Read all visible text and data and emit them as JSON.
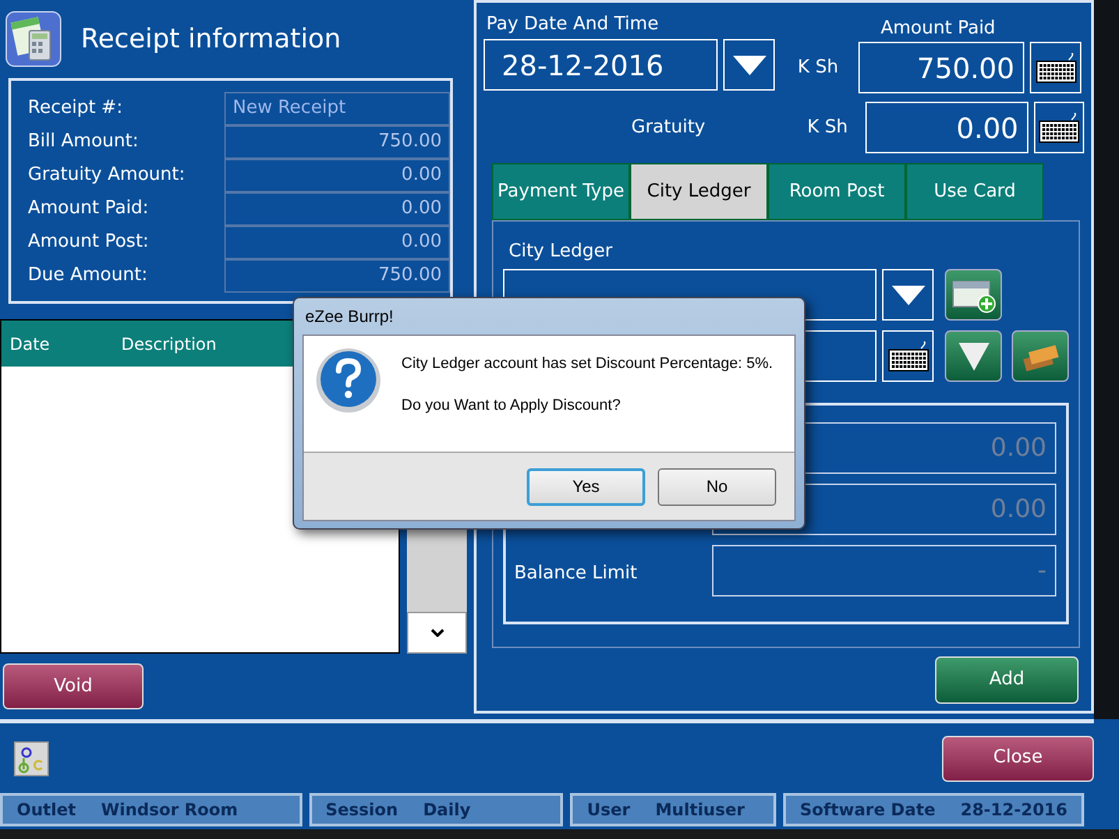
{
  "header": {
    "title": "Receipt information"
  },
  "receipt_info": [
    {
      "label": "Receipt #:",
      "value": "New Receipt",
      "kind": "text"
    },
    {
      "label": "Bill Amount:",
      "value": "750.00",
      "kind": "amount"
    },
    {
      "label": "Gratuity Amount:",
      "value": "0.00",
      "kind": "amount"
    },
    {
      "label": "Amount Paid:",
      "value": "0.00",
      "kind": "amount"
    },
    {
      "label": "Amount Post:",
      "value": "0.00",
      "kind": "amount"
    },
    {
      "label": "Due Amount:",
      "value": "750.00",
      "kind": "amount"
    }
  ],
  "transactions_table": {
    "columns": [
      "Date",
      "Description"
    ]
  },
  "void_button": "Void",
  "payment": {
    "pay_date_label": "Pay Date And Time",
    "pay_date": "28-12-2016",
    "amount_paid_label": "Amount Paid",
    "amount_currency": "K Sh",
    "amount_paid": "750.00",
    "gratuity_label": "Gratuity",
    "gratuity_currency": "K Sh",
    "gratuity": "0.00"
  },
  "tabs": [
    {
      "label": "Payment Type",
      "selected": false
    },
    {
      "label": "City Ledger",
      "selected": true
    },
    {
      "label": "Room Post",
      "selected": false
    },
    {
      "label": "Use Card",
      "selected": false
    }
  ],
  "city_ledger": {
    "label": "City Ledger",
    "amounts": [
      {
        "value": "0.00"
      },
      {
        "value": "0.00"
      },
      {
        "label": "Balance Limit",
        "value": "-"
      }
    ]
  },
  "add_button": "Add",
  "close_button": "Close",
  "status_bar": [
    {
      "label": "Outlet",
      "value": "Windsor Room"
    },
    {
      "label": "Session",
      "value": "Daily"
    },
    {
      "label": "User",
      "value": "Multiuser"
    },
    {
      "label": "Software Date",
      "value": "28-12-2016"
    }
  ],
  "dialog": {
    "title": "eZee Burrp!",
    "message": "City Ledger account has set Discount Percentage: 5%.",
    "question": "Do you Want to Apply Discount?",
    "buttons": [
      {
        "label": "Yes",
        "focused": true
      },
      {
        "label": "No",
        "focused": false
      }
    ]
  }
}
